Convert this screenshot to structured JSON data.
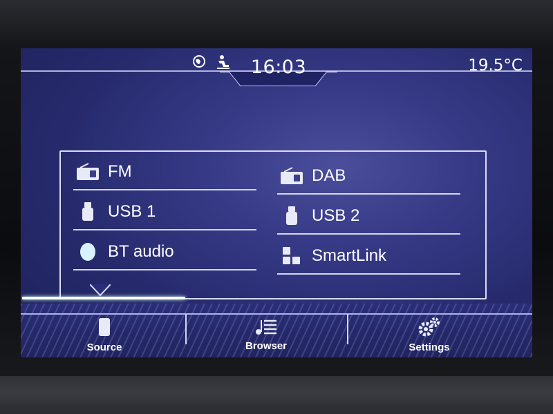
{
  "status_bar": {
    "time": "16:03",
    "temperature": "19.5°C",
    "icons": [
      "globe-icon",
      "person-icon"
    ]
  },
  "sources": [
    {
      "label": "FM",
      "icon": "radio-icon"
    },
    {
      "label": "DAB",
      "icon": "radio-icon"
    },
    {
      "label": "USB 1",
      "icon": "usb-icon"
    },
    {
      "label": "USB 2",
      "icon": "usb-icon"
    },
    {
      "label": "BT audio",
      "icon": "bluetooth-icon"
    },
    {
      "label": "SmartLink",
      "icon": "smartlink-icon"
    }
  ],
  "menu": {
    "source_label": "Source",
    "browser_label": "Browser",
    "settings_label": "Settings",
    "active": "Source"
  },
  "colors": {
    "screen_bg": "#272b6e",
    "text": "#ffffff",
    "active_highlight": "#c6f7ff"
  }
}
